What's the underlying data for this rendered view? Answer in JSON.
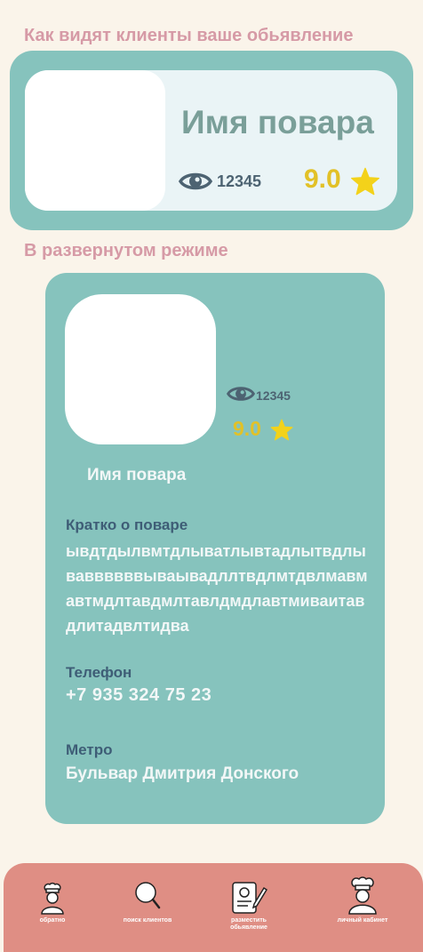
{
  "sections": {
    "preview_title": "Как видят клиенты ваше обьявление",
    "expanded_title": "В развернутом режиме"
  },
  "card": {
    "chef_name": "Имя повара",
    "views": "12345",
    "rating": "9.0"
  },
  "expanded": {
    "views": "12345",
    "rating": "9.0",
    "chef_name": "Имя повара",
    "about_label": "Кратко о поваре",
    "about_text": "ывдтдылвмтдлыватлывтадлытвдлываввввввываывадллтвдлмтдвлмавмавтмдлтавдмлтавлдмдлавтмиваитавдлитадвлтидва",
    "phone_label": "Телефон",
    "phone_value": "+7 935 324 75 23",
    "metro_label": "Метро",
    "metro_value": "Бульвар Дмитрия Донского"
  },
  "nav": {
    "items": [
      {
        "label": "обратно",
        "icon": "chef-icon"
      },
      {
        "label": "поиск клиентов",
        "icon": "search-icon"
      },
      {
        "label": "разместить обьявление",
        "icon": "document-pen-icon"
      },
      {
        "label": "личный кабинет",
        "icon": "profile-chef-icon"
      }
    ]
  },
  "colors": {
    "background": "#faf4ea",
    "card_teal": "#86c3bd",
    "card_light": "#eaf4f6",
    "title_pink": "#d69aa6",
    "rating_yellow": "#e2c127",
    "nav_bg": "#df8e84",
    "label_blue": "#3e5d76"
  }
}
